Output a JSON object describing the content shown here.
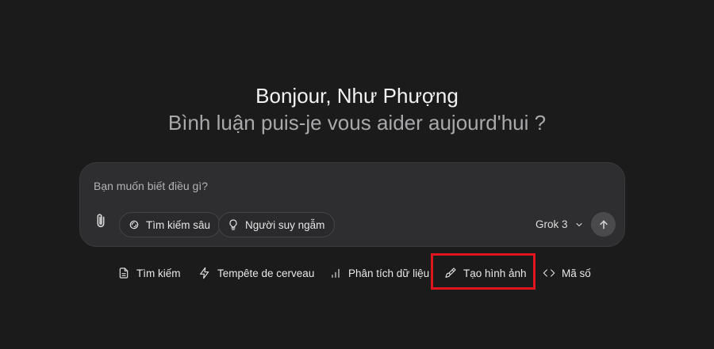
{
  "greeting": {
    "line1": "Bonjour, Như Phượng",
    "line2": "Bình luận puis-je vous aider aujourd'hui ?"
  },
  "composer": {
    "placeholder": "Bạn muốn biết điều gì?",
    "deepsearch_label": "Tìm kiếm sâu",
    "think_label": "Người suy ngẫm",
    "model_label": "Grok 3"
  },
  "actions": [
    {
      "label": "Tìm kiếm",
      "icon": "document-icon"
    },
    {
      "label": "Tempête de cerveau",
      "icon": "lightning-icon"
    },
    {
      "label": "Phân tích dữ liệu",
      "icon": "bar-chart-icon"
    },
    {
      "label": "Tạo hình ảnh",
      "icon": "paintbrush-icon"
    },
    {
      "label": "Mã số",
      "icon": "code-icon"
    }
  ],
  "colors": {
    "background": "#1b1b1c",
    "composer": "#2e2e30",
    "highlight": "#e0161e"
  }
}
